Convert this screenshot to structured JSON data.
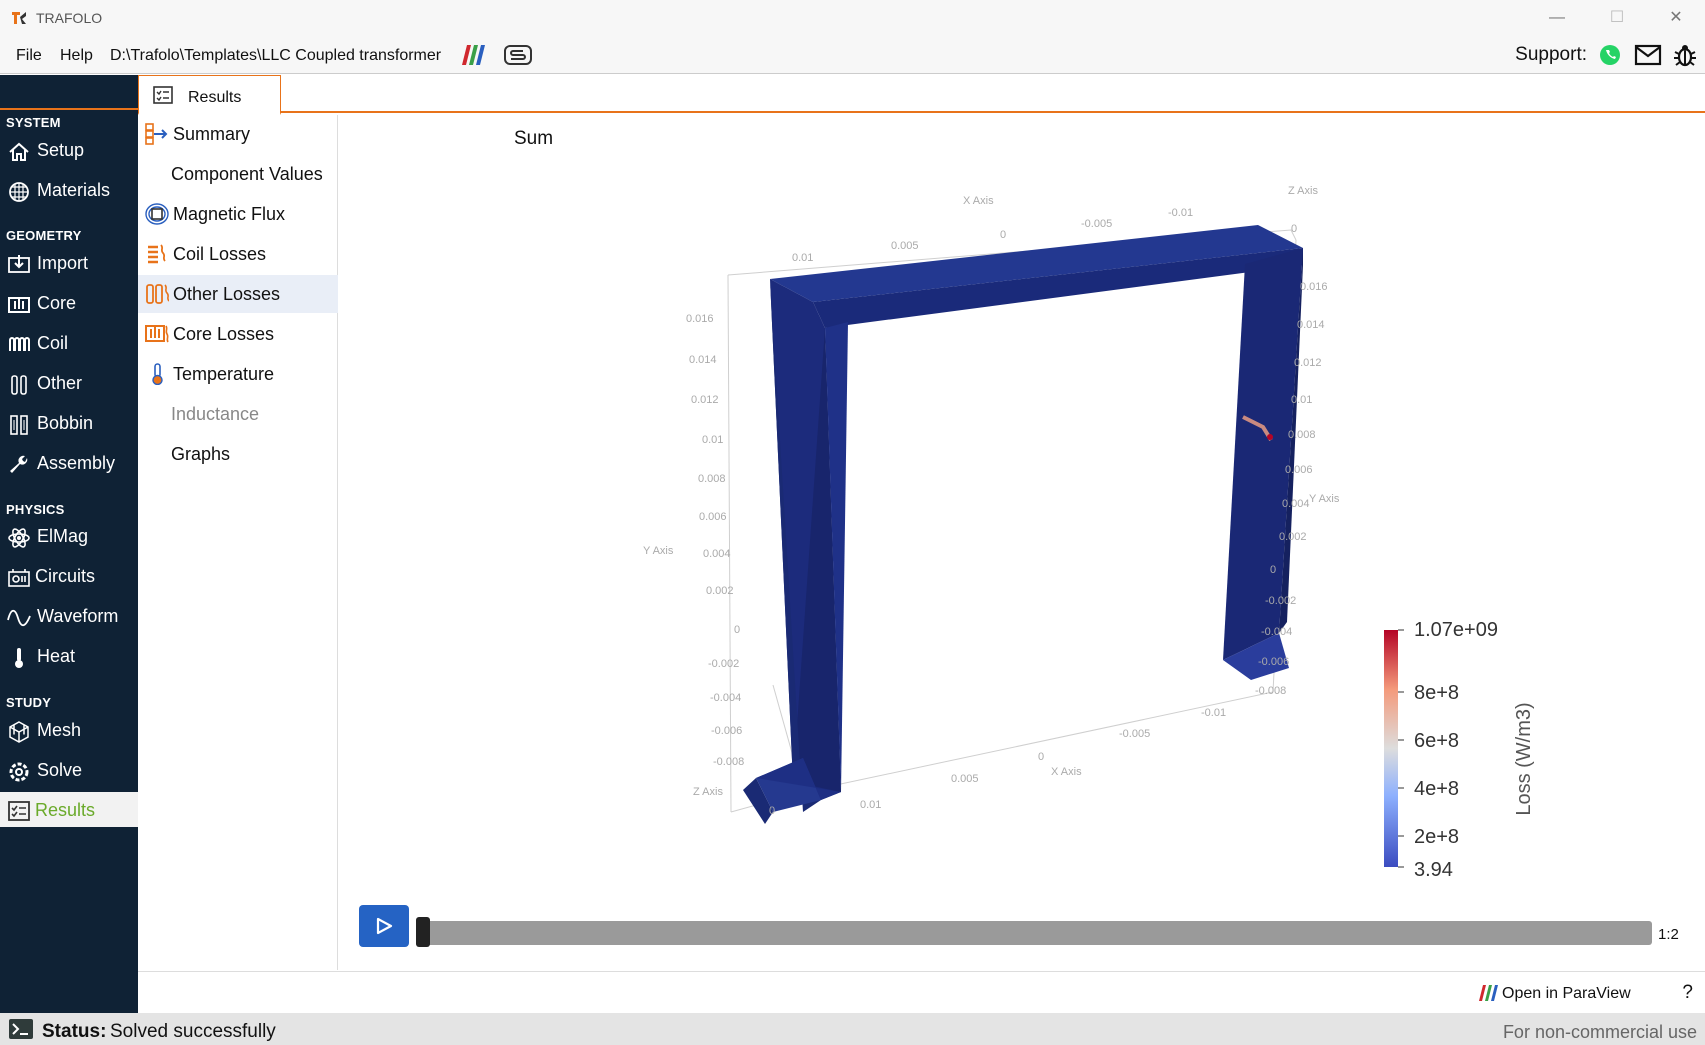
{
  "window": {
    "title": "TRAFOLO",
    "minimize": "—",
    "maximize": "☐",
    "close": "✕"
  },
  "menu": {
    "file": "File",
    "help": "Help",
    "path": "D:\\Trafolo\\Templates\\LLC Coupled transformer",
    "support": "Support:"
  },
  "sidebar": {
    "sections": [
      "SYSTEM",
      "GEOMETRY",
      "PHYSICS",
      "STUDY"
    ],
    "items": [
      {
        "label": "Setup",
        "icon": "home-icon"
      },
      {
        "label": "Materials",
        "icon": "globe-grid-icon"
      },
      {
        "label": "Import",
        "icon": "import-icon"
      },
      {
        "label": "Core",
        "icon": "core-icon"
      },
      {
        "label": "Coil",
        "icon": "coil-icon"
      },
      {
        "label": "Other",
        "icon": "other-icon"
      },
      {
        "label": "Bobbin",
        "icon": "bobbin-icon"
      },
      {
        "label": "Assembly",
        "icon": "wrench-icon"
      },
      {
        "label": "ElMag",
        "icon": "atom-icon"
      },
      {
        "label": "Circuits",
        "icon": "circuit-icon"
      },
      {
        "label": "Waveform",
        "icon": "sine-wave-icon"
      },
      {
        "label": "Heat",
        "icon": "thermometer-icon"
      },
      {
        "label": "Mesh",
        "icon": "mesh-icon"
      },
      {
        "label": "Solve",
        "icon": "solve-gear-icon"
      },
      {
        "label": "Results",
        "icon": "results-check-icon"
      }
    ]
  },
  "tab": {
    "label": "Results"
  },
  "results_nav": [
    {
      "label": "Summary"
    },
    {
      "label": "Component Values"
    },
    {
      "label": "Magnetic Flux"
    },
    {
      "label": "Coil Losses"
    },
    {
      "label": "Other Losses"
    },
    {
      "label": "Core Losses"
    },
    {
      "label": "Temperature"
    },
    {
      "label": "Inductance"
    },
    {
      "label": "Graphs"
    }
  ],
  "viewer": {
    "title": "Sum",
    "axis_labels": {
      "x": "X Axis",
      "y": "Y Axis",
      "z": "Z Axis"
    },
    "top_ticks": [
      "0.01",
      "0.005",
      "0",
      "-0.005",
      "-0.01",
      "0"
    ],
    "left_ticks": [
      "0.016",
      "0.014",
      "0.012",
      "0.01",
      "0.008",
      "0.006",
      "0.004",
      "0.002",
      "0",
      "-0.002",
      "-0.004",
      "-0.006",
      "-0.008",
      "0"
    ],
    "right_ticks": [
      "0.016",
      "0.014",
      "0.012",
      "0.01",
      "0.008",
      "0.006",
      "0.004",
      "0.002",
      "0",
      "-0.002",
      "-0.004",
      "-0.006",
      "-0.008"
    ],
    "bottom_ticks": [
      "0.01",
      "0.005",
      "0",
      "-0.005",
      "-0.01"
    ],
    "colorbar": {
      "title": "Loss (W/m3)",
      "labels": [
        "1.07e+09",
        "8e+8",
        "6e+8",
        "4e+8",
        "2e+8",
        "3.94"
      ]
    },
    "frame": "1:2"
  },
  "bottom": {
    "paraview": "Open in ParaView",
    "help": "?"
  },
  "status": {
    "label": "Status:",
    "text": "Solved successfully",
    "license": "For non-commercial use"
  },
  "colors": {
    "sidebar_bg": "#0f2235",
    "accent_orange": "#e8731a",
    "active_green": "#6aaa2a",
    "core_blue": "#1f2f8a",
    "play_blue": "#2563c4"
  }
}
